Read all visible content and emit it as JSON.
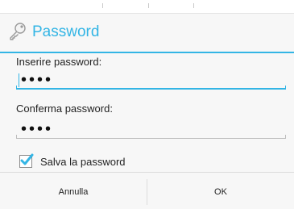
{
  "dialog": {
    "title": "Password",
    "title_icon": "key-icon",
    "accent_color": "#33b5e5"
  },
  "fields": {
    "password_label": "Inserire password:",
    "password_value": "••••",
    "confirm_label": "Conferma password:",
    "confirm_value": "••••"
  },
  "checkbox": {
    "label": "Salva la password",
    "checked": true
  },
  "buttons": {
    "cancel": "Annulla",
    "ok": "OK"
  }
}
